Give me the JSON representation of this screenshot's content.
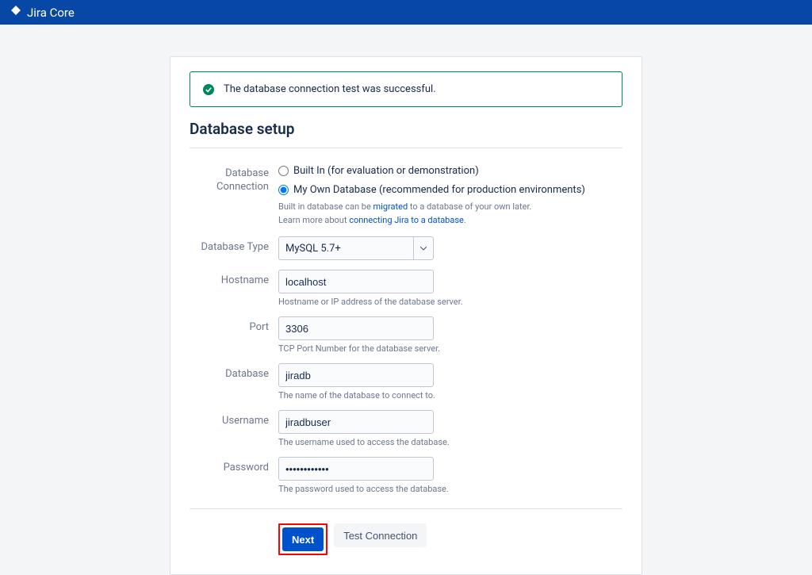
{
  "header": {
    "product_name": "Jira Core"
  },
  "banner": {
    "success_message": "The database connection test was successful."
  },
  "page": {
    "title": "Database setup"
  },
  "form": {
    "db_connection": {
      "label": "Database Connection",
      "options": [
        {
          "label": "Built In (for evaluation or demonstration)",
          "selected": false
        },
        {
          "label": "My Own Database (recommended for production environments)",
          "selected": true
        }
      ],
      "hint_prefix": "Built in database can be ",
      "hint_link1": "migrated",
      "hint_mid": " to a database of your own later.",
      "hint_learn": "Learn more about ",
      "hint_link2": "connecting Jira to a database",
      "hint_suffix": "."
    },
    "db_type": {
      "label": "Database Type",
      "value": "MySQL 5.7+"
    },
    "hostname": {
      "label": "Hostname",
      "value": "localhost",
      "hint": "Hostname or IP address of the database server."
    },
    "port": {
      "label": "Port",
      "value": "3306",
      "hint": "TCP Port Number for the database server."
    },
    "database": {
      "label": "Database",
      "value": "jiradb",
      "hint": "The name of the database to connect to."
    },
    "username": {
      "label": "Username",
      "value": "jiradbuser",
      "hint": "The username used to access the database."
    },
    "password": {
      "label": "Password",
      "value": "••••••••••••",
      "hint": "The password used to access the database."
    }
  },
  "buttons": {
    "next": "Next",
    "test_connection": "Test Connection"
  }
}
